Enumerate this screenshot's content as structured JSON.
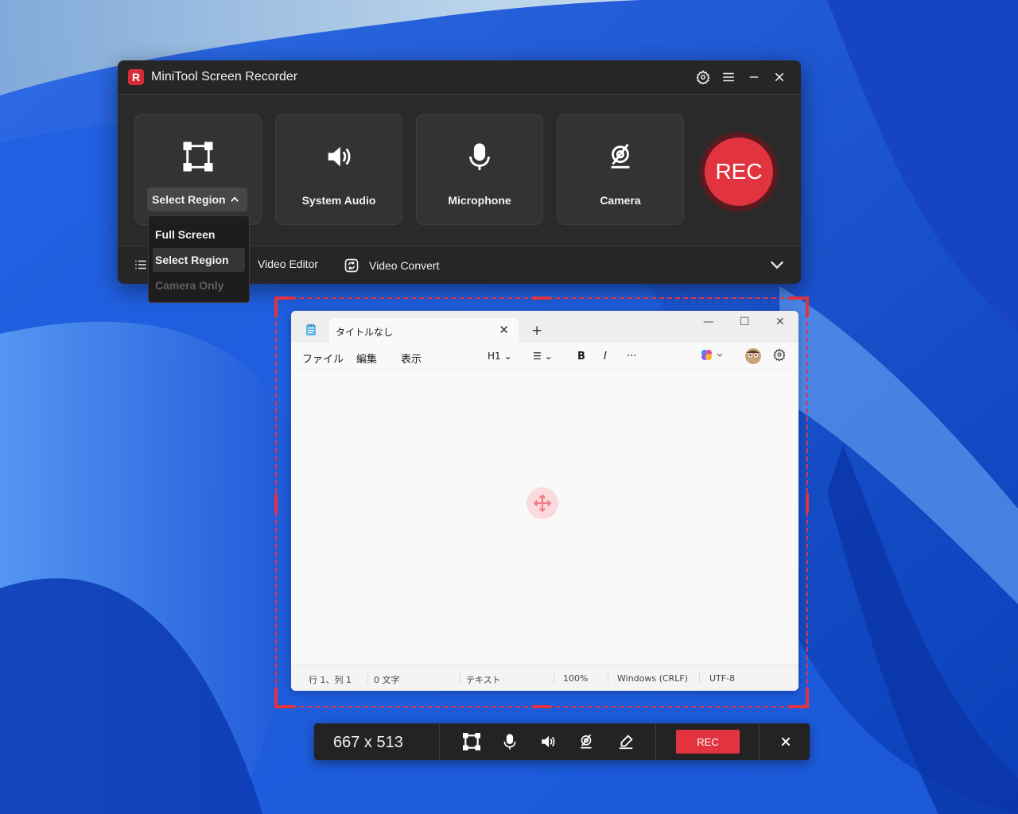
{
  "recorder": {
    "title": "MiniTool Screen Recorder",
    "logo_letter": "R",
    "tiles": {
      "region_selected": "Select Region",
      "system_audio": "System Audio",
      "microphone": "Microphone",
      "camera": "Camera"
    },
    "rec_label": "REC",
    "bottom": {
      "video_editor": "Video Editor",
      "video_convert": "Video Convert"
    },
    "dropdown": [
      "Full Screen",
      "Select Region",
      "Camera Only"
    ],
    "icons": [
      "gear-icon",
      "menu-icon",
      "minimize-icon",
      "close-icon"
    ]
  },
  "notepad": {
    "tab_title": "タイトルなし",
    "menu": [
      "ファイル",
      "編集",
      "表示"
    ],
    "heading": "H1",
    "bold": "B",
    "italic": "I",
    "more": "···",
    "status": [
      "行 1、列 1",
      "0 文字",
      "テキスト",
      "100%",
      "Windows (CRLF)",
      "UTF-8"
    ]
  },
  "toolbar": {
    "size": "667 x 513",
    "rec_label": "REC"
  },
  "colors": {
    "accent": "#e23440",
    "panel": "#2a2a2a"
  }
}
